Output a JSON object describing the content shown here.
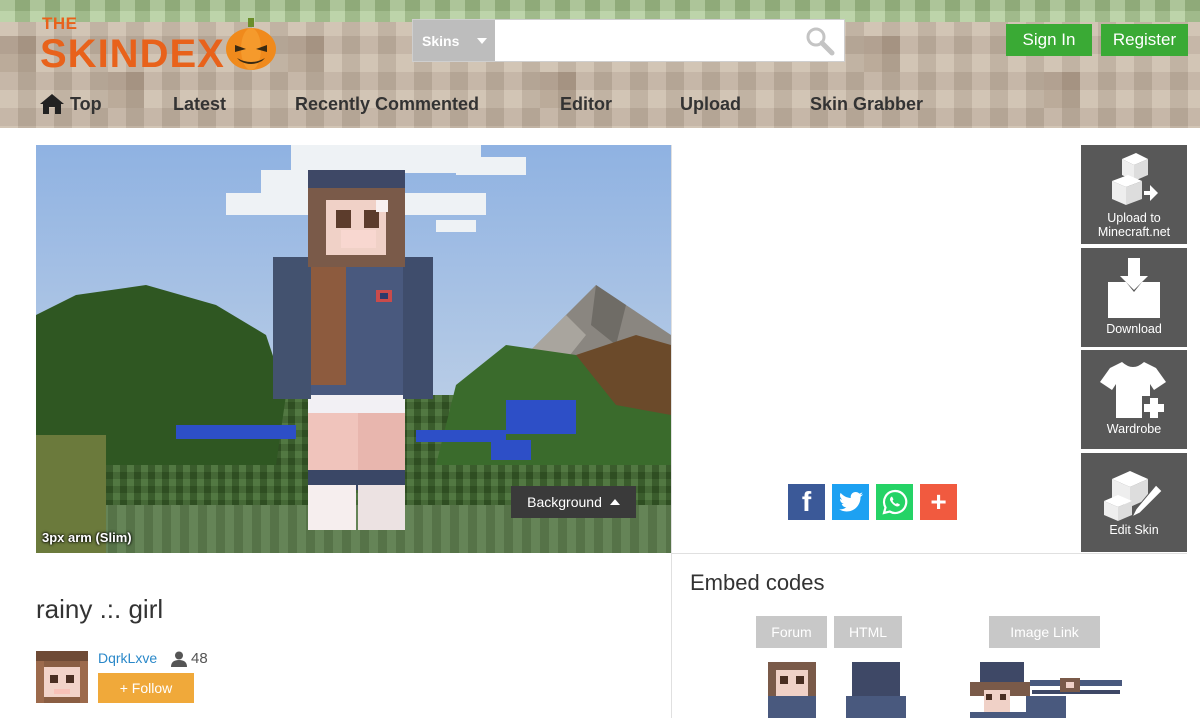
{
  "brand": {
    "the": "THE",
    "name": "SKINDEX"
  },
  "search": {
    "type_label": "Skins",
    "value": "",
    "placeholder": ""
  },
  "auth": {
    "sign_in": "Sign In",
    "register": "Register"
  },
  "nav": [
    {
      "label": "Top",
      "icon": "home-icon"
    },
    {
      "label": "Latest"
    },
    {
      "label": "Recently Commented"
    },
    {
      "label": "Editor"
    },
    {
      "label": "Upload"
    },
    {
      "label": "Skin Grabber"
    }
  ],
  "preview": {
    "background_label": "Background",
    "arm_label": "3px arm (Slim)"
  },
  "actions": {
    "upload_line1": "Upload to",
    "upload_line2": "Minecraft.net",
    "download": "Download",
    "wardrobe": "Wardrobe",
    "edit": "Edit Skin"
  },
  "share": {
    "facebook": "f",
    "more": "+"
  },
  "skin": {
    "title": "rainy .:. girl",
    "author": "DqrkLxve",
    "followers": "48",
    "follow_label": "+ Follow"
  },
  "embed": {
    "title": "Embed codes",
    "tabs": [
      "Forum",
      "HTML",
      "Image Link"
    ]
  },
  "colors": {
    "brand_orange": "#e8621b",
    "green": "#3aaa35",
    "follow": "#f0a93a",
    "action_gray": "#585858"
  }
}
